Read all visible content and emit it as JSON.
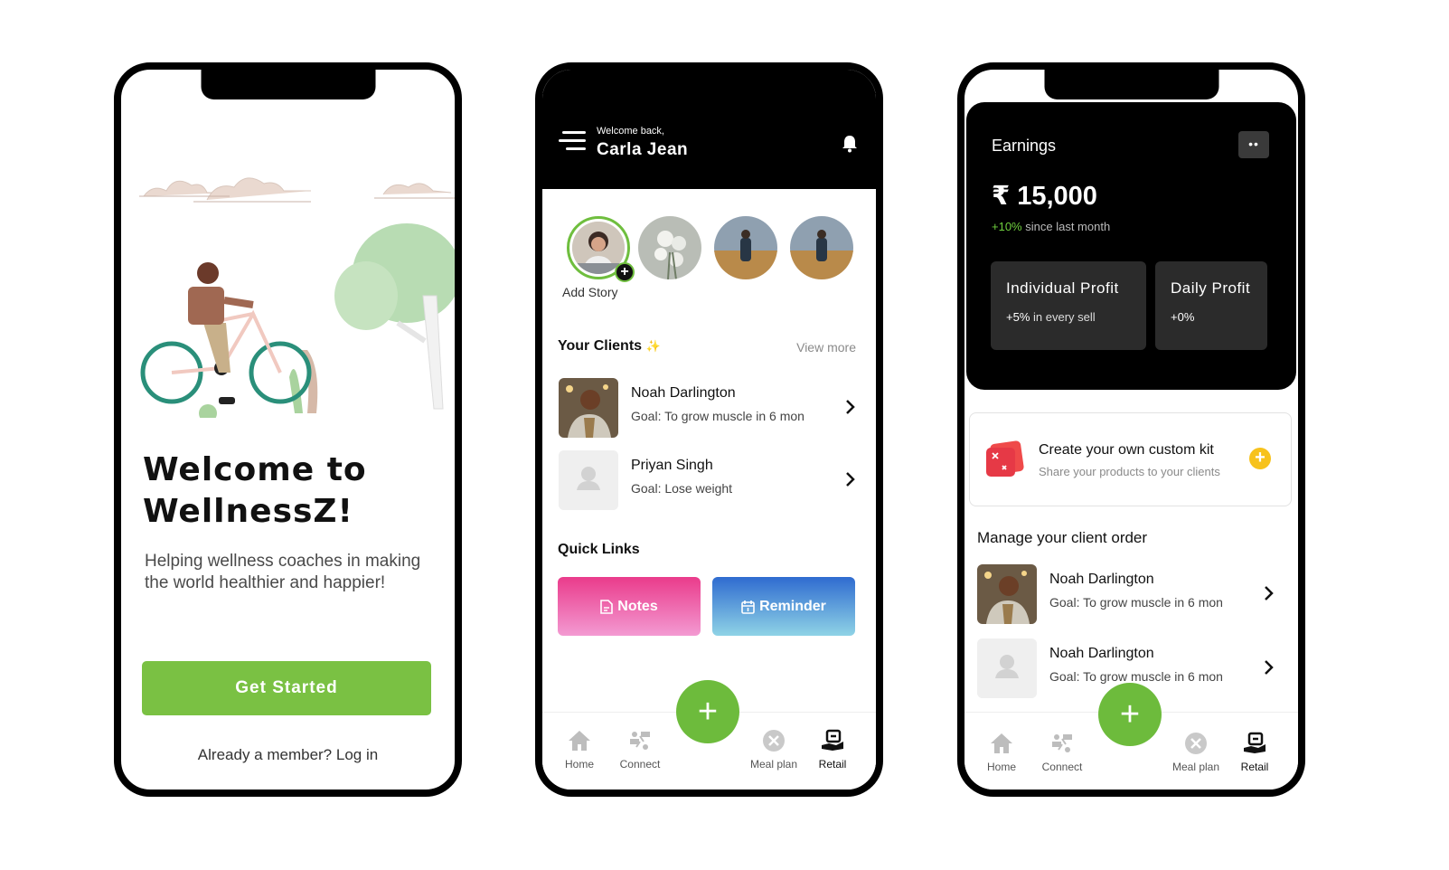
{
  "colors": {
    "brand_green": "#7ac143",
    "fab_green": "#6dbb3c",
    "black": "#000000",
    "accent_yellow": "#f7c21c",
    "positive_green": "#6fcf3e"
  },
  "screen1": {
    "title": "Welcome to WellnessZ!",
    "subtitle": "Helping wellness coaches in making the world healthier and happier!",
    "cta_label": "Get Started",
    "login_text": "Already a member? Log in"
  },
  "screen2": {
    "header": {
      "greeting": "Welcome back,",
      "user_name": "Carla Jean",
      "menu_icon": "hamburger-icon",
      "notification_icon": "bell-icon"
    },
    "stories": {
      "add_label": "Add Story",
      "add_icon": "plus-icon"
    },
    "clients_section": {
      "title": "Your Clients",
      "sparkle": "✨",
      "view_more": "View more"
    },
    "clients": [
      {
        "name": "Noah Darlington",
        "goal": "Goal: To grow muscle in 6 mon"
      },
      {
        "name": "Priyan Singh",
        "goal": "Goal: Lose weight"
      }
    ],
    "quick_links": {
      "title": "Quick Links",
      "notes": "Notes",
      "reminder": "Reminder"
    },
    "fab_icon": "plus-icon",
    "tabs": [
      "Home",
      "Connect",
      "Meal plan",
      "Retail"
    ],
    "active_tab": "Retail"
  },
  "screen3": {
    "earnings": {
      "title": "Earnings",
      "more_icon": "dots-icon",
      "amount": "₹ 15,000",
      "change_pct": "+10%",
      "change_text": " since last month",
      "individual_title": "Individual Profit",
      "individual_pct": "+5%",
      "individual_text": " in every sell",
      "daily_title": "Daily Profit",
      "daily_value": "+0%"
    },
    "kit": {
      "title": "Create your own custom kit",
      "subtitle": "Share your products to your clients",
      "icon": "kit-icon"
    },
    "orders_title": "Manage your client order",
    "orders": [
      {
        "name": "Noah Darlington",
        "goal": "Goal: To grow muscle in 6 mon"
      },
      {
        "name": "Noah Darlington",
        "goal": "Goal: To grow muscle in 6 mon"
      }
    ],
    "tabs": [
      "Home",
      "Connect",
      "Meal plan",
      "Retail"
    ],
    "active_tab": "Retail"
  }
}
